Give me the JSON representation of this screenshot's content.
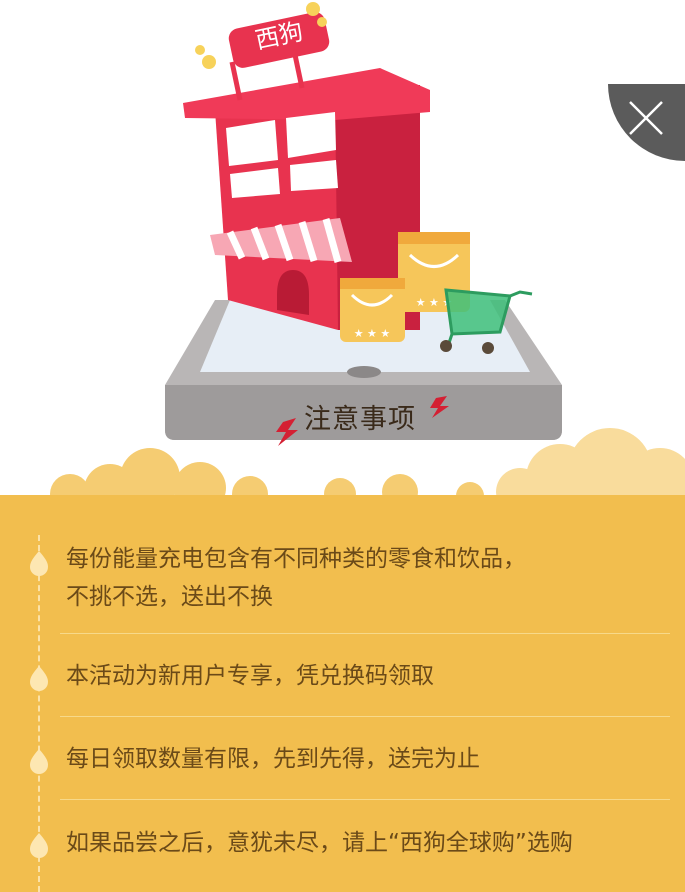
{
  "shop_sign": "西狗",
  "hero": {
    "title": "注意事项"
  },
  "rules": [
    {
      "line1": "每份能量充电包含有不同种类的零食和饮品，",
      "line2": "不挑不选，送出不换"
    },
    {
      "line1": "本活动为新用户专享，凭兑换码领取",
      "line2": ""
    },
    {
      "line1": "每日领取数量有限，先到先得，送完为止",
      "line2": ""
    },
    {
      "line1": "如果品尝之后，意犹未尽，请上“西狗全球购”选购",
      "line2": ""
    }
  ],
  "colors": {
    "panel": "#f2be4e",
    "text": "#6b4a18",
    "store_red": "#e8334f",
    "close_bg": "#5b5b5b"
  }
}
